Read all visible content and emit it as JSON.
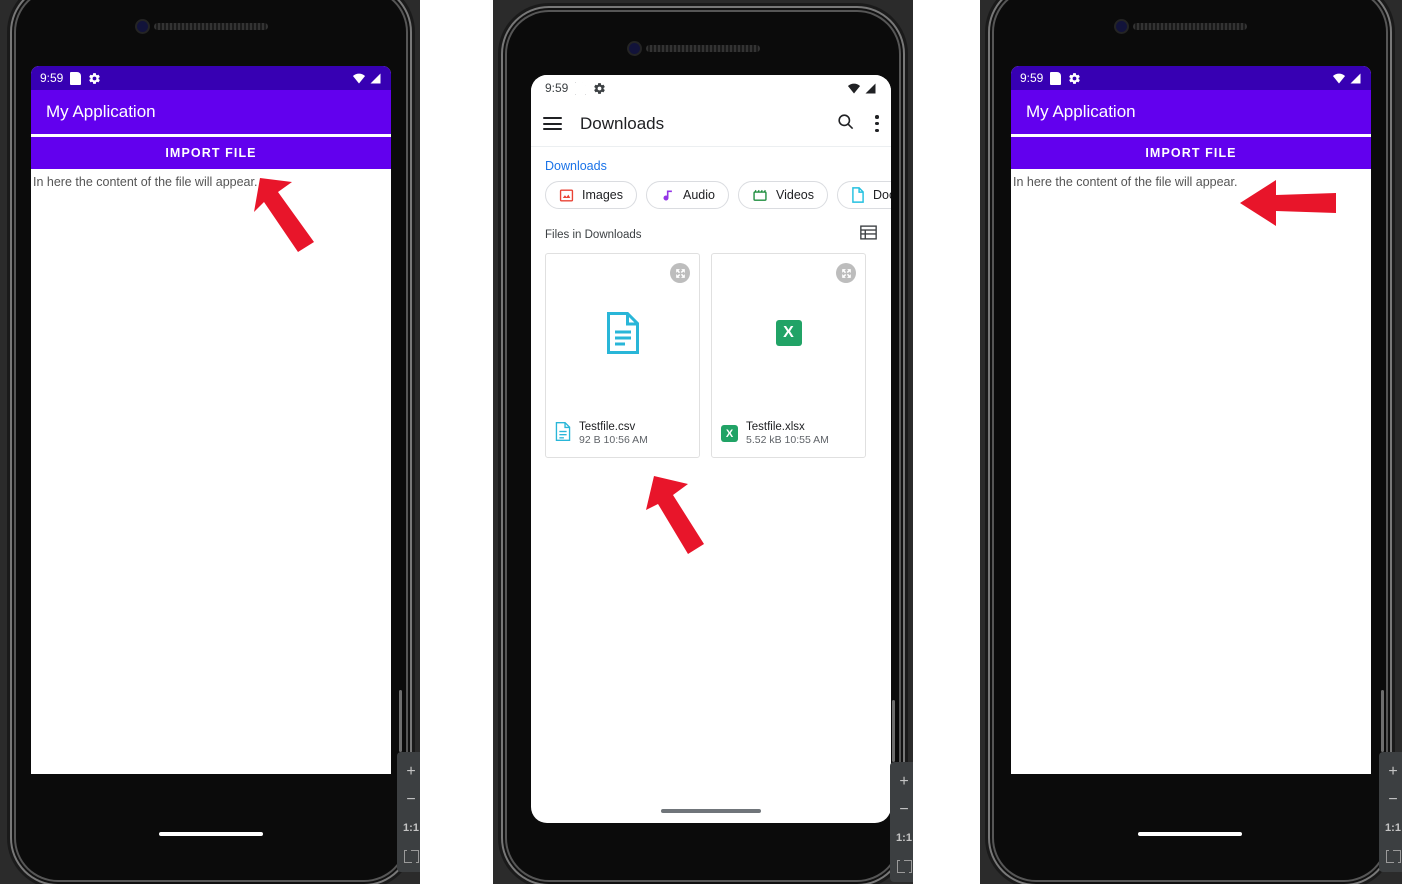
{
  "colors": {
    "primary": "#6200ee",
    "primary_dark": "#3700b3",
    "accent_arrow": "#e8152a",
    "breadcrumb_link": "#1a73e8",
    "csv_icon": "#29b6d8",
    "xlsx_green": "#21a366",
    "images_chip_icon": "#ea4335",
    "audio_chip_icon": "#9334e6",
    "videos_chip_icon": "#1e8e3e",
    "doc_chip_icon": "#24c1e0"
  },
  "panels": [
    {
      "id": "panel-left",
      "app": "my-application",
      "status_bar": {
        "time": "9:59",
        "icons": [
          "sd-card-icon",
          "gear-icon",
          "wifi-icon",
          "signal-icon"
        ]
      },
      "app_bar": {
        "title": "My Application"
      },
      "import_button": {
        "label": "IMPORT FILE"
      },
      "content_text": "In here the content of the file will appear.",
      "annotation": {
        "type": "arrow",
        "direction": "up-left",
        "target": "import-file-button"
      }
    },
    {
      "id": "panel-middle",
      "app": "files",
      "status_bar": {
        "time": "9:59",
        "icons": [
          "sd-card-icon",
          "gear-icon",
          "wifi-icon",
          "signal-icon"
        ]
      },
      "app_bar": {
        "title": "Downloads",
        "menu_icon": "hamburger-icon",
        "search_icon": "search-icon",
        "overflow_icon": "kebab-menu-icon"
      },
      "breadcrumb": "Downloads",
      "filter_chips": [
        {
          "label": "Images",
          "icon": "image-icon"
        },
        {
          "label": "Audio",
          "icon": "music-note-icon"
        },
        {
          "label": "Videos",
          "icon": "video-camera-icon"
        },
        {
          "label": "Doc",
          "icon": "document-icon",
          "truncated": true
        }
      ],
      "section": {
        "title": "Files in Downloads",
        "view_toggle_icon": "list-view-icon"
      },
      "files": [
        {
          "name": "Testfile.csv",
          "size": "92 B",
          "time": "10:56 AM",
          "icon": "csv-document-icon",
          "expand_icon": "expand-arrows-icon"
        },
        {
          "name": "Testfile.xlsx",
          "size": "5.52 kB",
          "time": "10:55 AM",
          "icon": "xlsx-badge-icon",
          "badge_letter": "X",
          "expand_icon": "expand-arrows-icon"
        }
      ],
      "annotation": {
        "type": "arrow",
        "direction": "up-left",
        "target": "testfile-csv-card"
      }
    },
    {
      "id": "panel-right",
      "app": "my-application",
      "status_bar": {
        "time": "9:59",
        "icons": [
          "sd-card-icon",
          "gear-icon",
          "wifi-icon",
          "signal-icon"
        ]
      },
      "app_bar": {
        "title": "My Application"
      },
      "import_button": {
        "label": "IMPORT FILE"
      },
      "content_text": "In here the content of the file will appear.",
      "annotation": {
        "type": "arrow",
        "direction": "left",
        "target": "content-text"
      }
    }
  ],
  "emulator_toolbar": {
    "zoom_in_label": "+",
    "zoom_out_label": "−",
    "actual_size_label": "1:1",
    "fit_label": "fit-screen-icon"
  }
}
